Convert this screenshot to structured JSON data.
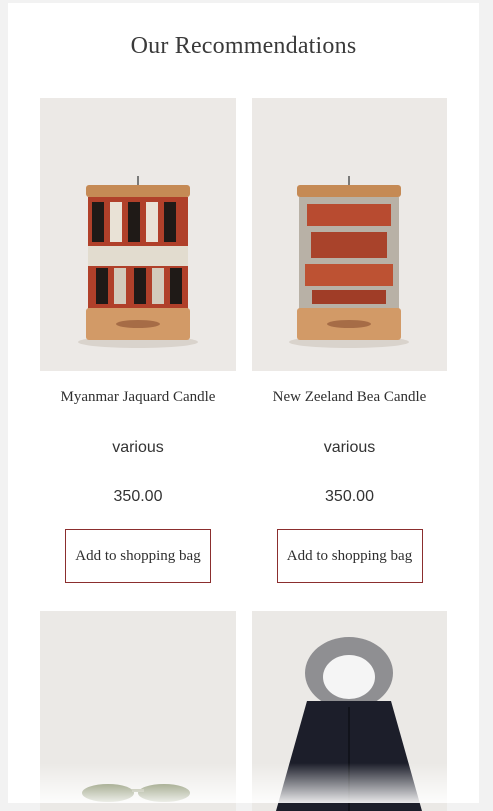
{
  "section": {
    "title": "Our Recommendations"
  },
  "products": [
    {
      "name": "Myanmar Jaquard Candle",
      "variant": "various",
      "price": "350.00",
      "button_label": "Add to shopping bag"
    },
    {
      "name": "New Zeeland Bea Candle",
      "variant": "various",
      "price": "350.00",
      "button_label": "Add to shopping bag"
    },
    {
      "name": "",
      "variant": "",
      "price": "",
      "button_label": ""
    },
    {
      "name": "",
      "variant": "",
      "price": "",
      "button_label": ""
    }
  ],
  "colors": {
    "button_border": "#8b2e2e",
    "background": "#f2f2f2",
    "card": "#ffffff"
  },
  "icons": [
    "candle-image",
    "sunglasses-image",
    "parka-image"
  ]
}
